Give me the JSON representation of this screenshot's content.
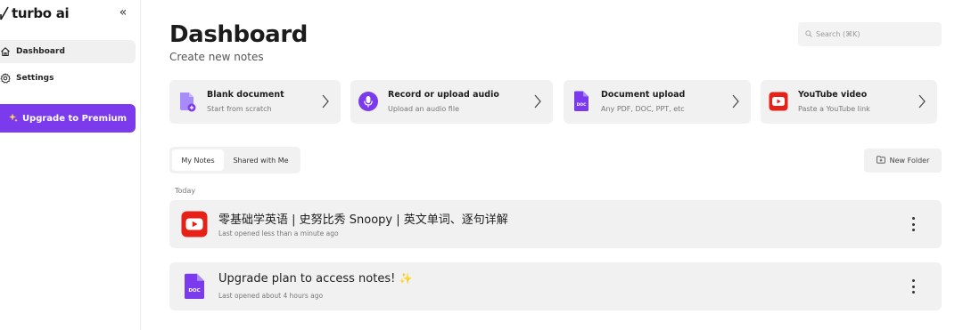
{
  "sidebar": {
    "brand": "turbo ai",
    "collapse_glyph": "«",
    "items": [
      {
        "label": "Dashboard",
        "icon": "home-icon",
        "active": true
      },
      {
        "label": "Settings",
        "icon": "gear-icon",
        "active": false
      }
    ],
    "upgrade": {
      "label": "Upgrade to Premium",
      "icon": "sparkle-icon"
    }
  },
  "main": {
    "title": "Dashboard",
    "subtitle": "Create new notes",
    "search": {
      "placeholder": "Search (⌘K)"
    },
    "actions": [
      {
        "title": "Blank document",
        "subtitle": "Start from scratch",
        "icon": "blank-document-icon"
      },
      {
        "title": "Record or upload audio",
        "subtitle": "Upload an audio file",
        "icon": "microphone-icon"
      },
      {
        "title": "Document upload",
        "subtitle": "Any PDF, DOC, PPT, etc",
        "icon": "doc-file-icon"
      },
      {
        "title": "YouTube video",
        "subtitle": "Paste a YouTube link",
        "icon": "youtube-icon"
      }
    ],
    "tabs": [
      {
        "label": "My Notes",
        "active": true
      },
      {
        "label": "Shared with Me",
        "active": false
      }
    ],
    "new_folder": {
      "label": "New Folder",
      "icon": "folder-plus-icon"
    },
    "section_label": "Today",
    "notes": [
      {
        "title": "零基础学英语 | 史努比秀 Snoopy | 英文单词、逐句详解",
        "subtitle": "Last opened less than a minute ago",
        "icon": "youtube-icon"
      },
      {
        "title": "Upgrade plan to access notes!",
        "subtitle": "Last opened about 4 hours ago",
        "icon": "doc-file-icon",
        "badge": "✨"
      }
    ],
    "doc_label": "DOC"
  },
  "colors": {
    "accent": "#7c3aed",
    "youtube": "#e62117",
    "card_bg": "#f1f1f1"
  }
}
